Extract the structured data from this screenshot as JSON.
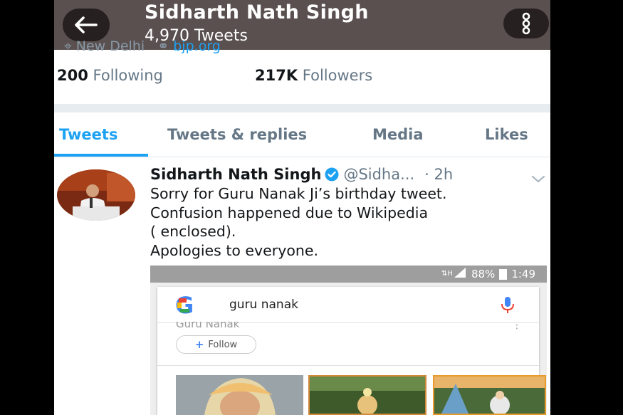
{
  "header": {
    "name": "Sidharth Nath Singh",
    "tweet_count": "4,970 Tweets"
  },
  "profile": {
    "location": "New Delhi",
    "website": "bjp.org",
    "following_count": "200",
    "following_label": "Following",
    "followers_count": "217K",
    "followers_label": "Followers"
  },
  "tabs": [
    {
      "label": "Tweets",
      "active": true
    },
    {
      "label": "Tweets & replies",
      "active": false
    },
    {
      "label": "Media",
      "active": false
    },
    {
      "label": "Likes",
      "active": false
    }
  ],
  "tweet": {
    "author": "Sidharth Nath Singh",
    "handle": "@Sidha...",
    "time": "· 2h",
    "text_lines": [
      "Sorry for Guru Nanak Ji’s birthday tweet.",
      "Confusion happened due to Wikipedia",
      "( enclosed).",
      "Apologies to everyone."
    ],
    "media": {
      "status_battery": "88%",
      "status_time": "1:49",
      "search_query": "guru nanak",
      "partial_title": "Guru Nanak",
      "follow_label": "Follow"
    }
  },
  "colors": {
    "accent": "#1da1f2",
    "header_bg": "#5a5050",
    "text": "#14171a",
    "muted": "#657786"
  }
}
